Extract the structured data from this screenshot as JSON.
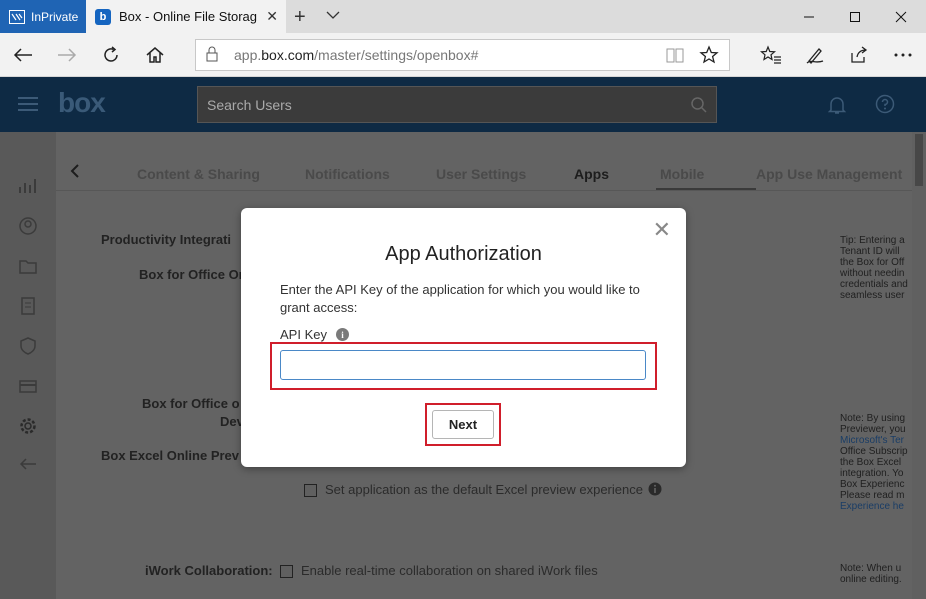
{
  "browser": {
    "inprivate_label": "InPrivate",
    "tab_title": "Box - Online File Storag",
    "favicon_letter": "b",
    "url_prefix": "app.",
    "url_host": "box.com",
    "url_path": "/master/settings/openbox#"
  },
  "app": {
    "logo": "box",
    "search_placeholder": "Search Users",
    "tabs": [
      "Content & Sharing",
      "Notifications",
      "User Settings",
      "Apps",
      "Mobile",
      "App Use Management"
    ],
    "active_tab": "Apps"
  },
  "background": {
    "section_title": "Productivity Integrati",
    "box_for_office": "Box for Office Or",
    "box_for_office_dev_line1": "Box for Office o",
    "box_for_office_dev_line2": "Dev",
    "excel_preview": "Box Excel Online Prev",
    "excel_default_option": "Set application as the default Excel preview experience",
    "iwork_label": "iWork Collaboration:",
    "iwork_option": "Enable real-time collaboration on shared iWork files",
    "tip1": [
      "Tip: Entering a",
      "Tenant ID will",
      "the Box for Off",
      "without needin",
      "credentials and",
      "seamless user"
    ],
    "tip2": [
      "Note: By using",
      "Previewer, you",
      "Microsoft's Ter",
      "Office Subscrip",
      "the Box Excel",
      "integration. Yo",
      "Box Experienc",
      "Please read m",
      "Experience he"
    ],
    "tip3": [
      "Note: When u",
      "online editing."
    ]
  },
  "modal": {
    "title": "App Authorization",
    "description": "Enter the API Key of the application for which you would like to grant access:",
    "api_key_label": "API Key",
    "api_key_value": "",
    "next_label": "Next",
    "close_glyph": "✕"
  },
  "colors": {
    "highlight": "#d01e2b",
    "header": "#0e2a44",
    "inprivate": "#1f64b4"
  }
}
